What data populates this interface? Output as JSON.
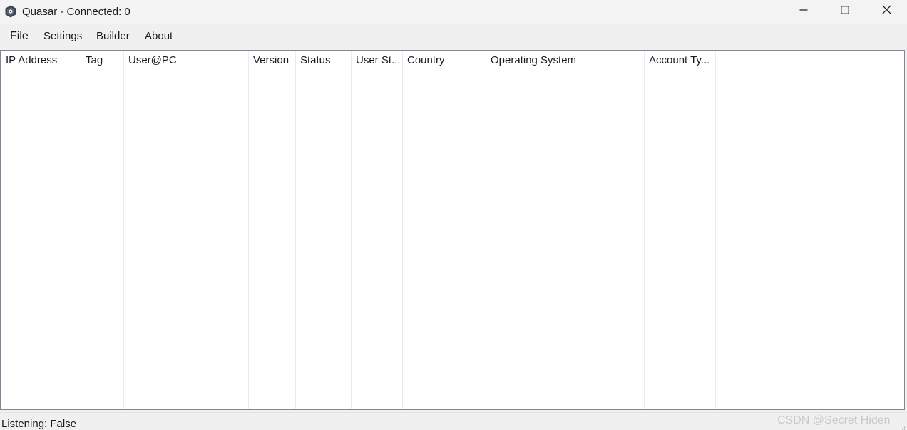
{
  "window": {
    "title": "Quasar - Connected: 0",
    "icon": "quasar-logo-icon",
    "controls": [
      "minimize-icon",
      "maximize-icon",
      "close-icon"
    ]
  },
  "menu": {
    "file": "File",
    "settings": "Settings",
    "builder": "Builder",
    "about": "About"
  },
  "table": {
    "columns": [
      "IP Address",
      "Tag",
      "User@PC",
      "Version",
      "Status",
      "User St...",
      "Country",
      "Operating System",
      "Account Ty..."
    ],
    "rows": []
  },
  "status": {
    "text": "Listening: False"
  },
  "watermark": "CSDN @Secret Hiden"
}
